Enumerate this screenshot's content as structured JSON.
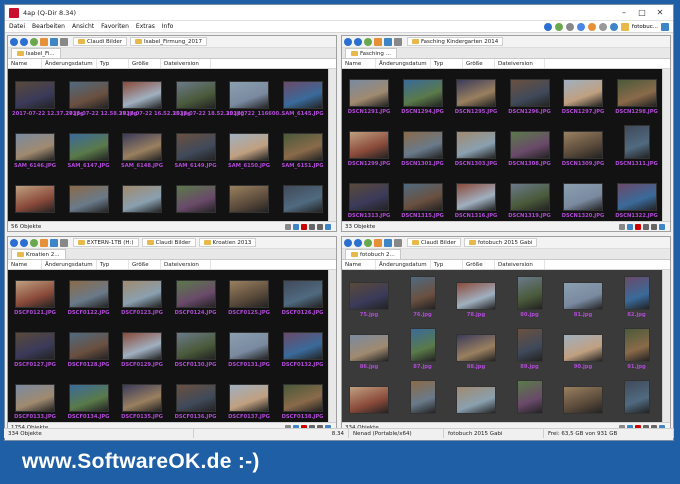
{
  "window": {
    "title": "4ap (Q-Dir 8.34)",
    "minimize": "–",
    "maximize": "□",
    "close": "✕"
  },
  "menu": [
    "Datei",
    "Bearbeiten",
    "Ansicht",
    "Favoriten",
    "Extras",
    "Info"
  ],
  "menu_right_label": "fotobuc...",
  "panes": [
    {
      "id": "tl",
      "crumbs": [
        "Claudi Bilder",
        "Isabel_Firmung_2017"
      ],
      "tab": "Isabel_Fi...",
      "columns": [
        "Name",
        "Änderungsdatum",
        "Typ",
        "Größe",
        "Dateiversion"
      ],
      "dark": true,
      "status": "56 Objekte",
      "rows": [
        [
          "2017-07-22 12.37.27.jpg",
          "2017-07-22 12.58.37.jpg",
          "2017-07-22 16.52.35.jpg",
          "2017-07-22 18.52.35.jpg",
          "20170722_116600...",
          "SAM_6145.JPG"
        ],
        [
          "SAM_6146.JPG",
          "SAM_6147.JPG",
          "SAM_6148.JPG",
          "SAM_6149.JPG",
          "SAM_6150.JPG",
          "SAM_6151.JPG"
        ],
        [
          "",
          "",
          "",
          "",
          "",
          ""
        ]
      ]
    },
    {
      "id": "tr",
      "crumbs": [
        "Fasching Kindergarten 2014"
      ],
      "tab": "Fasching ...",
      "columns": [
        "Name",
        "Änderungsdatum",
        "Typ",
        "Größe",
        "Dateiversion"
      ],
      "dark": true,
      "status": "33 Objekte",
      "rows": [
        [
          "DSCN1291.JPG",
          "DSCN1294.JPG",
          "DSCN1295.JPG",
          "DSCN1296.JPG",
          "DSCN1297.JPG",
          "DSCN1298.JPG"
        ],
        [
          "DSCN1299.JPG",
          "DSCN1301.JPG",
          "DSCN1303.JPG",
          "DSCN1308.JPG",
          "DSCN1309.JPG",
          "DSCN1311.JPG"
        ],
        [
          "DSCN1313.JPG",
          "DSCN1315.JPG",
          "DSCN1316.JPG",
          "DSCN1319.JPG",
          "DSCN1320.JPG",
          "DSCN1322.JPG"
        ]
      ]
    },
    {
      "id": "bl",
      "crumbs": [
        "EXTERN-1TB (H:)",
        "Claudi Bilder",
        "Kroatien 2013"
      ],
      "tab": "Kroatien 2...",
      "columns": [
        "Name",
        "Änderungsdatum",
        "Typ",
        "Größe",
        "Dateiversion"
      ],
      "dark": true,
      "status": "1754 Objekte",
      "rows": [
        [
          "DSCF0121.JPG",
          "DSCF0122.JPG",
          "DSCF0123.JPG",
          "DSCF0124.JPG",
          "DSCF0125.JPG",
          "DSCF0126.JPG"
        ],
        [
          "DSCF0127.JPG",
          "DSCF0128.JPG",
          "DSCF0129.JPG",
          "DSCF0130.JPG",
          "DSCF0131.JPG",
          "DSCF0132.JPG"
        ],
        [
          "DSCF0133.JPG",
          "DSCF0134.JPG",
          "DSCF0135.JPG",
          "DSCF0136.JPG",
          "DSCF0137.JPG",
          "DSCF0138.JPG"
        ]
      ]
    },
    {
      "id": "br",
      "crumbs": [
        "Claudi Bilder",
        "fotobuch 2015 Gabi"
      ],
      "tab": "fotobuch 2...",
      "columns": [
        "Name",
        "Änderungsdatum",
        "Typ",
        "Größe",
        "Dateiversion"
      ],
      "dark": false,
      "status": "334 Objekte",
      "rows": [
        [
          "75.jpg",
          "76.jpg",
          "78.jpg",
          "80.jpg",
          "81.jpg",
          "82.jpg"
        ],
        [
          "86.jpg",
          "87.jpg",
          "88.jpg",
          "89.jpg",
          "90.jpg",
          "91.jpg"
        ],
        [
          "",
          "",
          "",
          "",
          "",
          ""
        ]
      ]
    }
  ],
  "bottom_status": [
    "334 Objekte",
    "8.34",
    "Nenad (Portable/x64)",
    "fotobuch 2015 Gabi",
    "Frei: 63,5 GB von 931 GB"
  ],
  "brand": "www.SoftwareOK.de :-)",
  "colors": {
    "dark_bg": "#121212",
    "light_bg": "#3a3a3a",
    "filename": "#b04ad6",
    "brand_bg": "#1e5fa6"
  }
}
